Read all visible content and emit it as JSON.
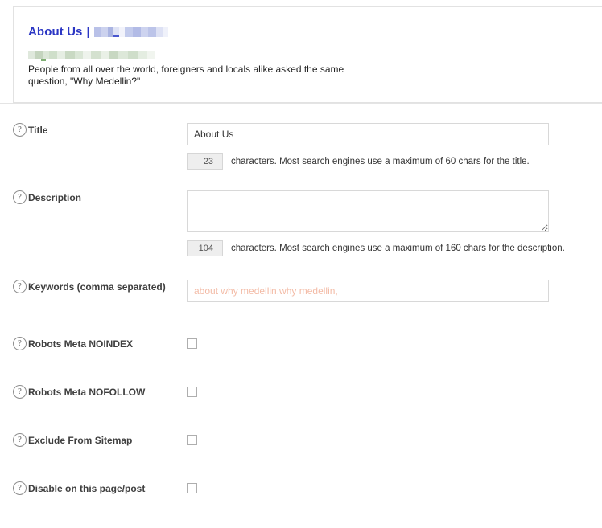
{
  "preview": {
    "title": "About Us",
    "title_separator": "|",
    "title_redacted": "",
    "url_redacted": "",
    "description": "People from all over the world, foreigners and locals alike asked the same question, \"Why Medellin?\""
  },
  "form": {
    "help_icon_glyph": "?",
    "fields": [
      {
        "name": "title",
        "label": "Title",
        "value": "About Us",
        "placeholder": "",
        "counter": "23",
        "counter_text": "characters. Most search engines use a maximum of 60 chars for the title."
      },
      {
        "name": "description",
        "label": "Description",
        "value": "",
        "placeholder": "",
        "counter": "104",
        "counter_text": "characters. Most search engines use a maximum of 160 chars for the description."
      },
      {
        "name": "keywords",
        "label": "Keywords (comma separated)",
        "value": "",
        "placeholder": "about why medellin,why medellin,"
      }
    ],
    "checkboxes": [
      {
        "name": "robots-meta-noindex",
        "label": "Robots Meta NOINDEX",
        "checked": false
      },
      {
        "name": "robots-meta-nofollow",
        "label": "Robots Meta NOFOLLOW",
        "checked": false
      },
      {
        "name": "exclude-from-sitemap",
        "label": "Exclude From Sitemap",
        "checked": false
      },
      {
        "name": "disable-on-this-page",
        "label": "Disable on this page/post",
        "checked": false
      }
    ]
  },
  "colors": {
    "serp_title": "#2b36c4",
    "placeholder": "#f3bba6",
    "counter_bg": "#eeeeee",
    "border": "#d8d8d8"
  }
}
